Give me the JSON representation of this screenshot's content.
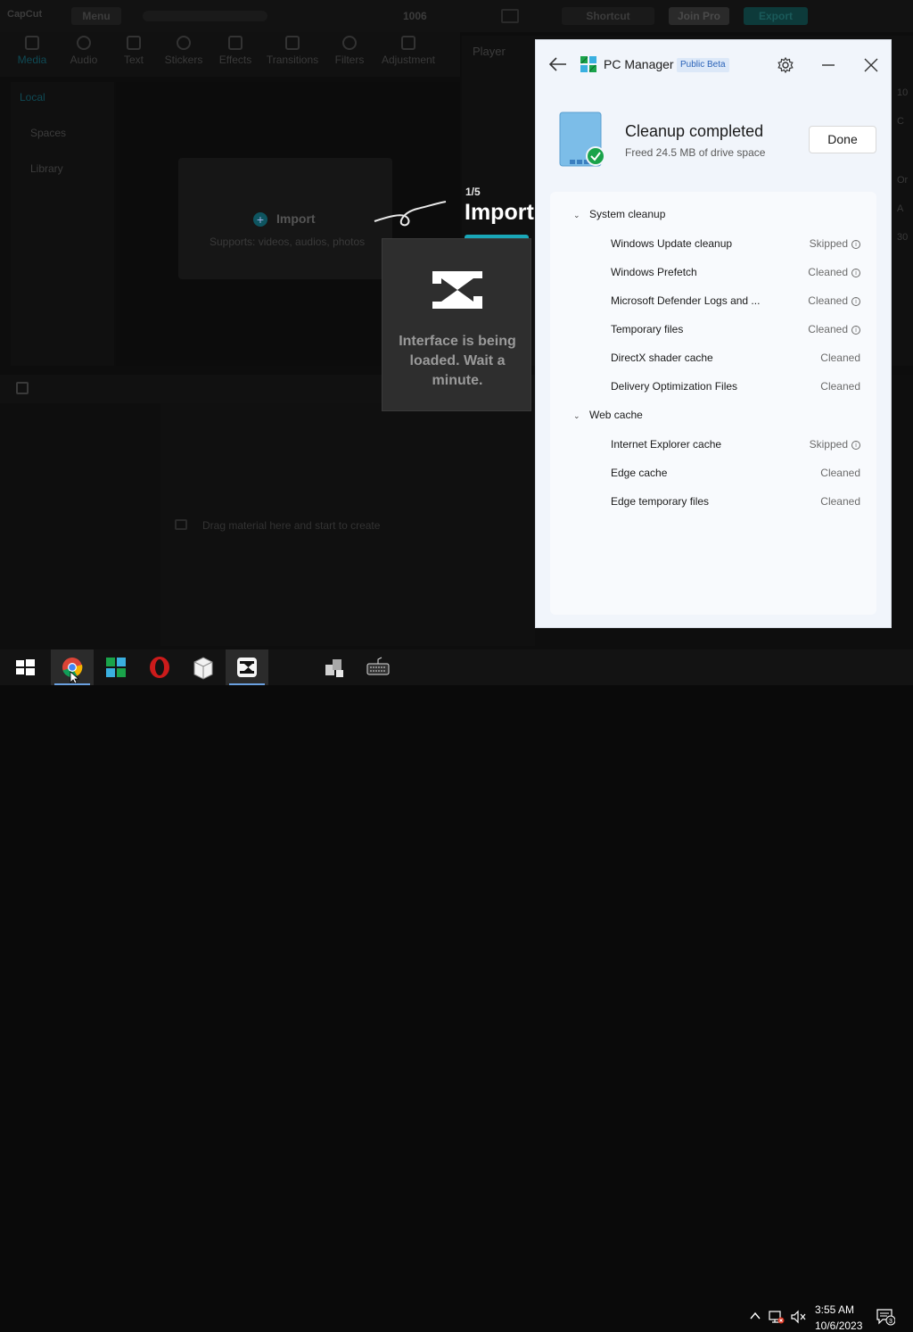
{
  "capcut": {
    "logo": "CapCut",
    "menu": "Menu",
    "zoom": "1006",
    "shortcut": "Shortcut",
    "join_pro": "Join Pro",
    "export": "Export",
    "tools": [
      "Media",
      "Audio",
      "Text",
      "Stickers",
      "Effects",
      "Transitions",
      "Filters",
      "Adjustment"
    ],
    "sidebar": [
      "Local",
      "Spaces",
      "Library"
    ],
    "import_label": "Import",
    "import_sub": "Supports: videos, audios, photos",
    "player": "Player",
    "drag_hint": "Drag material here and start to create",
    "tutorial": {
      "step": "1/5",
      "title": "Import"
    },
    "loading_text": "Interface is being loaded. Wait a minute."
  },
  "pc_manager": {
    "title": "PC Manager",
    "badge": "Public Beta",
    "status_title": "Cleanup completed",
    "status_sub": "Freed 24.5 MB of drive space",
    "done_label": "Done",
    "groups": [
      {
        "name": "System cleanup",
        "items": [
          {
            "label": "Windows Update cleanup",
            "status": "Skipped",
            "info": true
          },
          {
            "label": "Windows Prefetch",
            "status": "Cleaned",
            "info": true
          },
          {
            "label": "Microsoft Defender Logs and ...",
            "status": "Cleaned",
            "info": true
          },
          {
            "label": "Temporary files",
            "status": "Cleaned",
            "info": true
          },
          {
            "label": "DirectX shader cache",
            "status": "Cleaned",
            "info": false
          },
          {
            "label": "Delivery Optimization Files",
            "status": "Cleaned",
            "info": false
          }
        ]
      },
      {
        "name": "Web cache",
        "items": [
          {
            "label": "Internet Explorer cache",
            "status": "Skipped",
            "info": true
          },
          {
            "label": "Edge cache",
            "status": "Cleaned",
            "info": false
          },
          {
            "label": "Edge temporary files",
            "status": "Cleaned",
            "info": false
          }
        ]
      }
    ],
    "colors": {
      "accent": "#2b63b8",
      "success": "#1aa34a",
      "background": "#f1f5fb"
    }
  },
  "taskbar": {
    "apps": [
      "start-icon",
      "chrome-icon",
      "pc-manager-icon",
      "opera-icon",
      "package-icon",
      "capcut-icon",
      "network-app-icon",
      "keyboard-icon"
    ],
    "time": "3:55 AM",
    "date": "10/6/2023",
    "notification_count": "3"
  }
}
